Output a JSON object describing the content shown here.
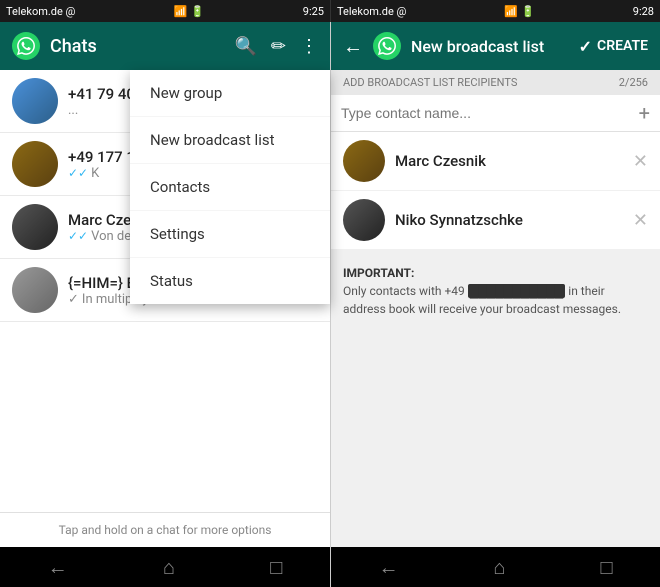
{
  "left": {
    "status_bar": {
      "carrier": "Telekom.de @",
      "time": "9:25",
      "icons": "📶 🔋"
    },
    "header": {
      "title": "Chats",
      "search_label": "search",
      "compose_label": "compose",
      "menu_label": "more"
    },
    "chats": [
      {
        "name": "+41 79 40...",
        "preview": "...",
        "avatar_color": "avatar-blue"
      },
      {
        "name": "+49 177 1...",
        "preview": "✓✓ K",
        "avatar_color": "avatar-brown"
      },
      {
        "name": "Marc Czes...",
        "preview": "✓✓ Von der f...",
        "avatar_color": "avatar-dark"
      },
      {
        "name": "{=HIM=} B...",
        "preview": "✓ In multiplayer!",
        "avatar_color": "avatar-gray"
      }
    ],
    "dropdown": {
      "items": [
        "New group",
        "New broadcast list",
        "Contacts",
        "Settings",
        "Status"
      ]
    },
    "bottom_hint": "Tap and hold on a chat for more options",
    "nav": {
      "back": "←",
      "home": "⌂",
      "recent": "▭"
    }
  },
  "right": {
    "status_bar": {
      "carrier": "Telekom.de @",
      "time": "9:28",
      "icons": "📶 🔋"
    },
    "header": {
      "title": "New broadcast list",
      "create_label": "CREATE",
      "check": "✓"
    },
    "recipients": {
      "label": "ADD BROADCAST LIST RECIPIENTS",
      "count": "2/256",
      "search_placeholder": "Type contact name...",
      "items": [
        {
          "name": "Marc Czesnik"
        },
        {
          "name": "Niko Synnatzschke"
        }
      ]
    },
    "notice": {
      "heading": "IMPORTANT:",
      "text1": "Only contacts with +49 ",
      "redacted": "███████████",
      "text2": " in their address book will receive your broadcast messages."
    },
    "nav": {
      "back": "←",
      "home": "⌂",
      "recent": "▭"
    }
  }
}
